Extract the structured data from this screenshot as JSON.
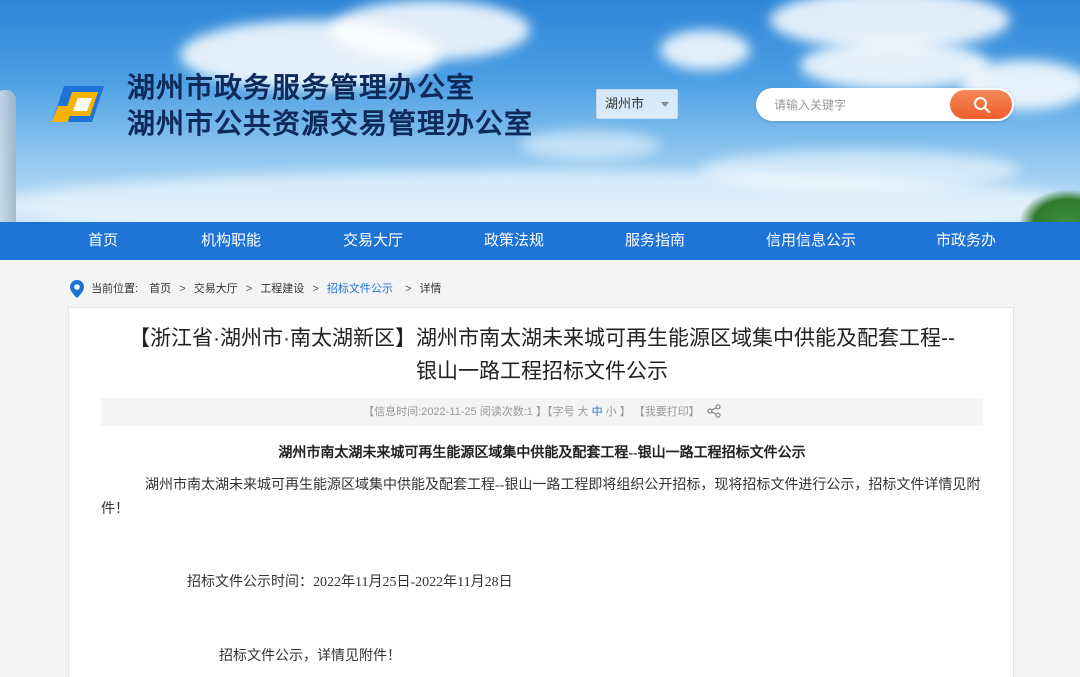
{
  "header": {
    "title_line1": "湖州市政务服务管理办公室",
    "title_line2": "湖州市公共资源交易管理办公室",
    "city_select": "湖州市",
    "search_placeholder": "请输入关键字"
  },
  "nav": {
    "items": [
      "首页",
      "机构职能",
      "交易大厅",
      "政策法规",
      "服务指南",
      "信用信息公示",
      "市政务办"
    ]
  },
  "breadcrumb": {
    "label": "当前位置:",
    "items": [
      "首页",
      "交易大厅",
      "工程建设",
      "招标文件公示",
      "详情"
    ]
  },
  "article": {
    "title_line1": "【浙江省·湖州市·南太湖新区】湖州市南太湖未来城可再生能源区域集中供能及配套工程--",
    "title_line2": "银山一路工程招标文件公示",
    "meta": {
      "info_time_label": "【信息时间:",
      "date": "2022-11-25",
      "views_label": "阅读次数:",
      "views": "1",
      "close_bracket": "】",
      "font_size_label": "【字号",
      "size_large": "大",
      "size_medium": "中",
      "size_small": "小",
      "font_size_close": "】",
      "print_label": "【我要打印】"
    },
    "subtitle": "湖州市南太湖未来城可再生能源区域集中供能及配套工程--银山一路工程招标文件公示",
    "paragraph1": "湖州市南太湖未来城可再生能源区域集中供能及配套工程--银山一路工程即将组织公开招标，现将招标文件进行公示，招标文件详情见附件！",
    "paragraph2": "招标文件公示时间：2022年11月25日-2022年11月28日",
    "paragraph3": "招标文件公示，详情见附件！"
  },
  "colors": {
    "nav_blue": "#1e73d6",
    "search_orange": "#ee5e2b",
    "title_navy": "#0d2a5a"
  },
  "icons": [
    "logo-icon",
    "search-icon",
    "location-pin-icon",
    "share-icon",
    "chevron-down-icon"
  ]
}
